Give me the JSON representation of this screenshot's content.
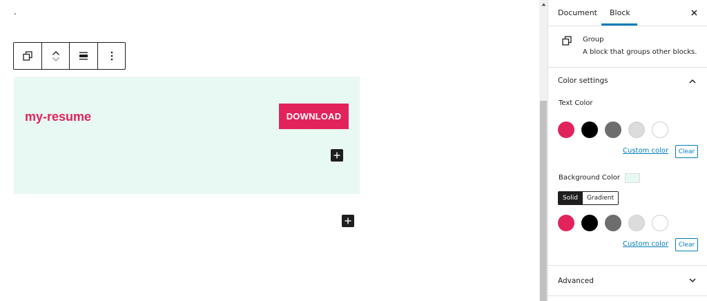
{
  "canvas": {
    "paragraph_text": ".",
    "site_title": "my-resume",
    "download_label": "DOWNLOAD"
  },
  "toolbar": {
    "icons": [
      "group-icon",
      "move-up-icon",
      "move-down-icon",
      "align-icon",
      "more-options-icon"
    ]
  },
  "sidebar": {
    "tabs": {
      "document": "Document",
      "block": "Block"
    },
    "block_card": {
      "title": "Group",
      "description": "A block that groups other blocks."
    },
    "color_settings": {
      "title": "Color settings",
      "text_color_label": "Text Color",
      "background_color_label": "Background Color",
      "custom_color_label": "Custom color",
      "clear_label": "Clear",
      "solid_label": "Solid",
      "gradient_label": "Gradient"
    },
    "advanced_title": "Advanced"
  },
  "colors": {
    "accent": "#e2235b",
    "group_background": "#e8f8f2",
    "link": "#007cba",
    "palette": [
      "#e2235b",
      "#000000",
      "#6d6d6d",
      "#dcdcdc",
      "#ffffff"
    ]
  }
}
